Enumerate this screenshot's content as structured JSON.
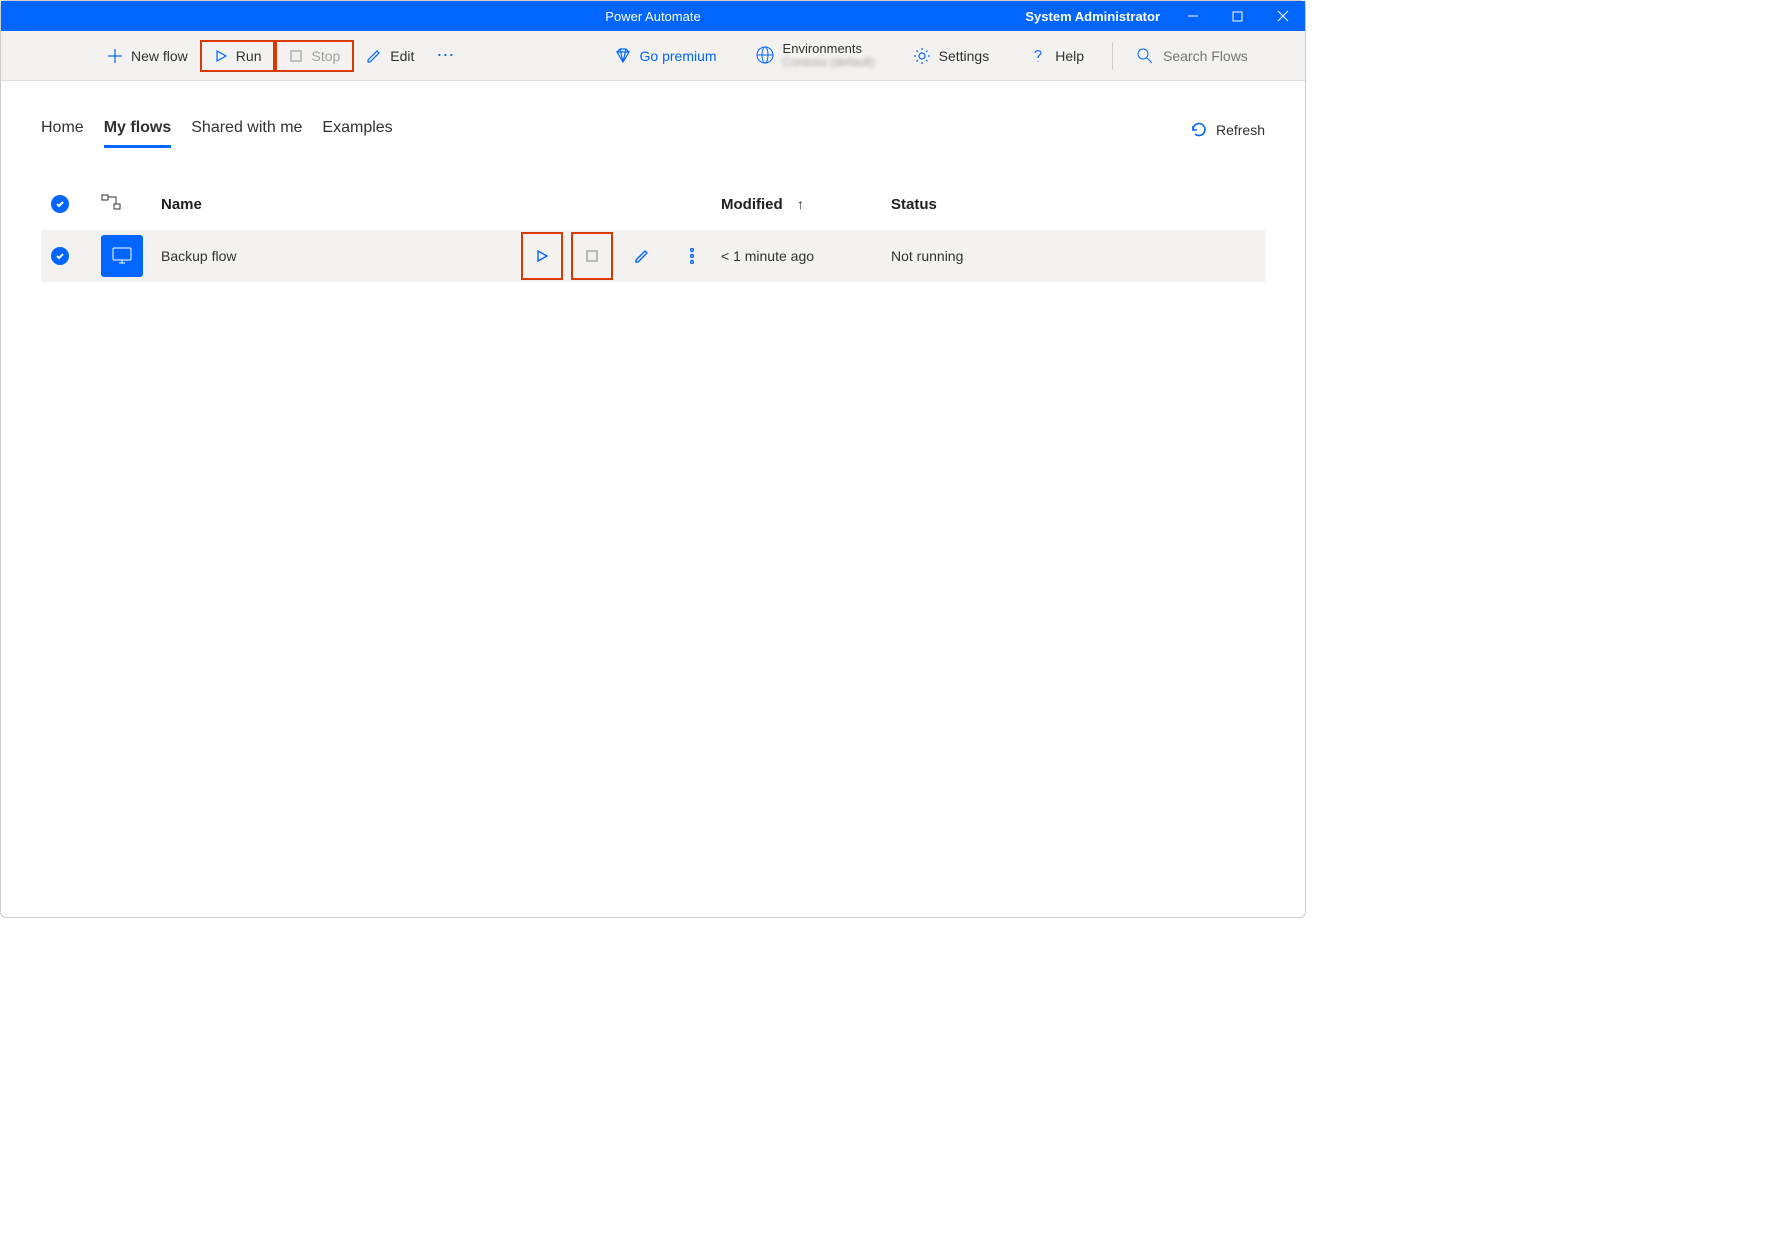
{
  "titlebar": {
    "app_title": "Power Automate",
    "user": "System Administrator"
  },
  "toolbar": {
    "new_flow": "New flow",
    "run": "Run",
    "stop": "Stop",
    "edit": "Edit",
    "go_premium": "Go premium",
    "environments_label": "Environments",
    "environments_name": "Contoso (default)",
    "settings": "Settings",
    "help": "Help",
    "search_placeholder": "Search Flows"
  },
  "tabs": {
    "home": "Home",
    "my_flows": "My flows",
    "shared": "Shared with me",
    "examples": "Examples",
    "refresh": "Refresh"
  },
  "table": {
    "col_name": "Name",
    "col_modified": "Modified",
    "col_status": "Status",
    "rows": [
      {
        "name": "Backup flow",
        "modified": "< 1 minute ago",
        "status": "Not running"
      }
    ]
  }
}
